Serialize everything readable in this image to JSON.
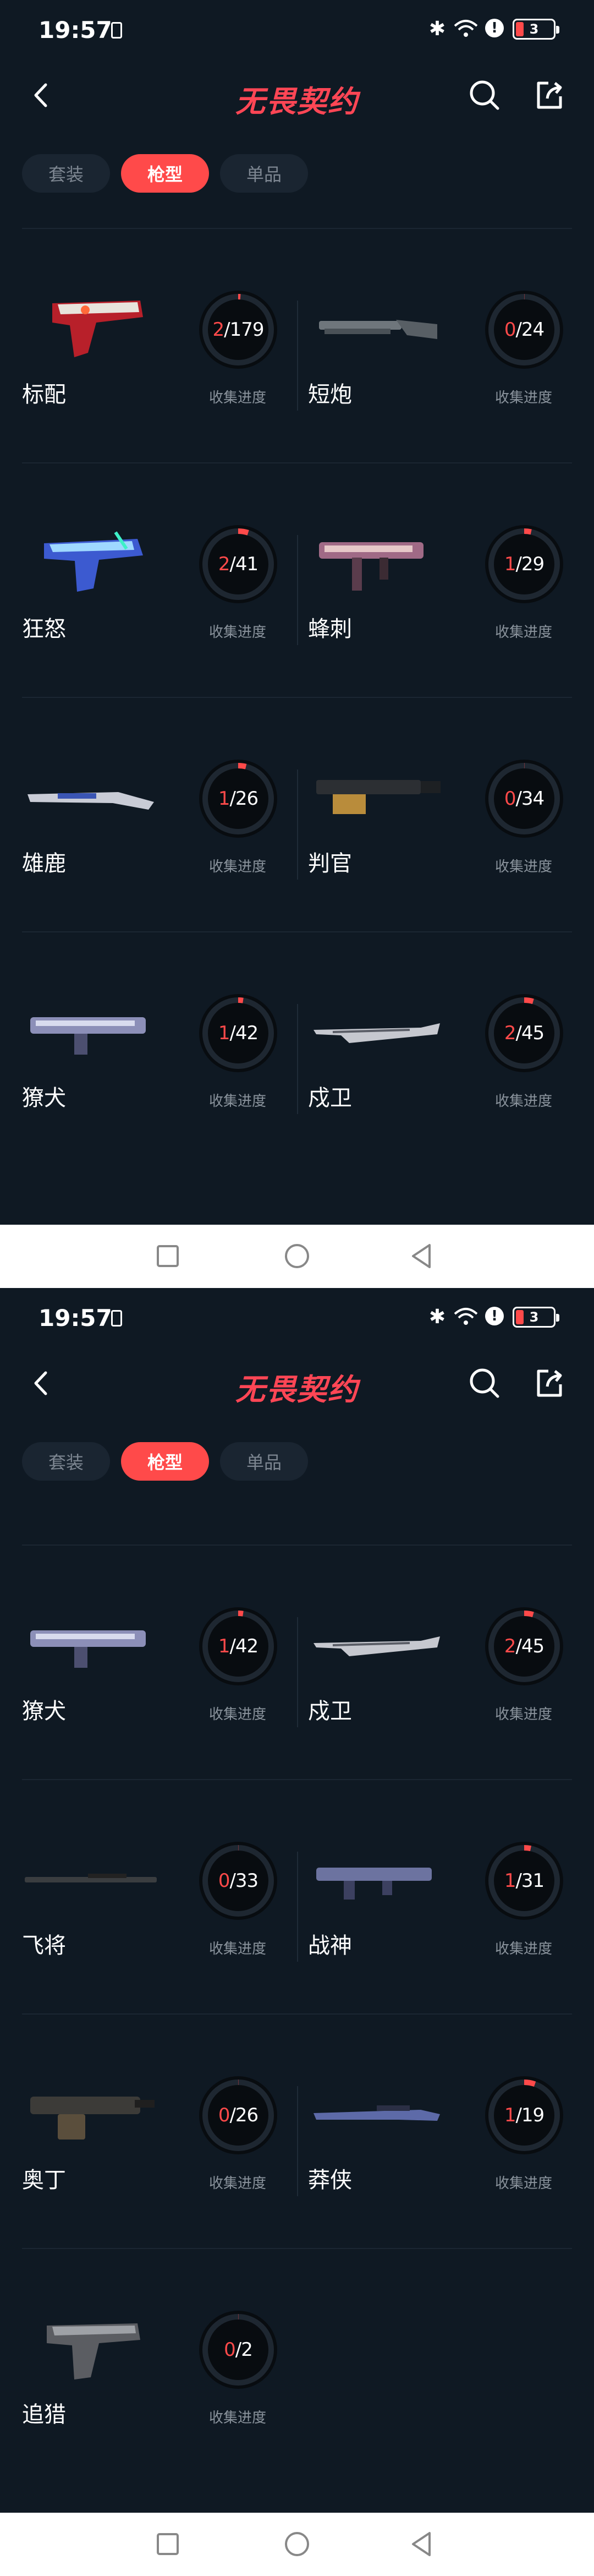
{
  "status": {
    "time": "19:57",
    "battery": "3"
  },
  "app": {
    "title": "无畏契约"
  },
  "tabs": [
    {
      "label": "套装"
    },
    {
      "label": "枪型"
    },
    {
      "label": "单品"
    }
  ],
  "progress_label": "收集进度",
  "screens": [
    {
      "weapons": [
        {
          "name": "标配",
          "collected": "2",
          "total": "179",
          "fraction": 0.011
        },
        {
          "name": "短炮",
          "collected": "0",
          "total": "24",
          "fraction": 0
        },
        {
          "name": "狂怒",
          "collected": "2",
          "total": "41",
          "fraction": 0.049
        },
        {
          "name": "蜂刺",
          "collected": "1",
          "total": "29",
          "fraction": 0.034
        },
        {
          "name": "雄鹿",
          "collected": "1",
          "total": "26",
          "fraction": 0.038
        },
        {
          "name": "判官",
          "collected": "0",
          "total": "34",
          "fraction": 0
        },
        {
          "name": "獠犬",
          "collected": "1",
          "total": "42",
          "fraction": 0.024
        },
        {
          "name": "戍卫",
          "collected": "2",
          "total": "45",
          "fraction": 0.044
        }
      ]
    },
    {
      "weapons": [
        {
          "name": "獠犬",
          "collected": "1",
          "total": "42",
          "fraction": 0.024
        },
        {
          "name": "戍卫",
          "collected": "2",
          "total": "45",
          "fraction": 0.044
        },
        {
          "name": "飞将",
          "collected": "0",
          "total": "33",
          "fraction": 0
        },
        {
          "name": "战神",
          "collected": "1",
          "total": "31",
          "fraction": 0.032
        },
        {
          "name": "奥丁",
          "collected": "0",
          "total": "26",
          "fraction": 0
        },
        {
          "name": "莽侠",
          "collected": "1",
          "total": "19",
          "fraction": 0.053
        },
        {
          "name": "追猎",
          "collected": "0",
          "total": "2",
          "fraction": 0
        }
      ]
    }
  ],
  "colors": {
    "accent": "#ff4a4a",
    "background": "#0f1923",
    "ring_track": "#0a0f14"
  },
  "icons": {
    "back": "chevron-left-icon",
    "search": "search-icon",
    "share": "share-icon"
  }
}
